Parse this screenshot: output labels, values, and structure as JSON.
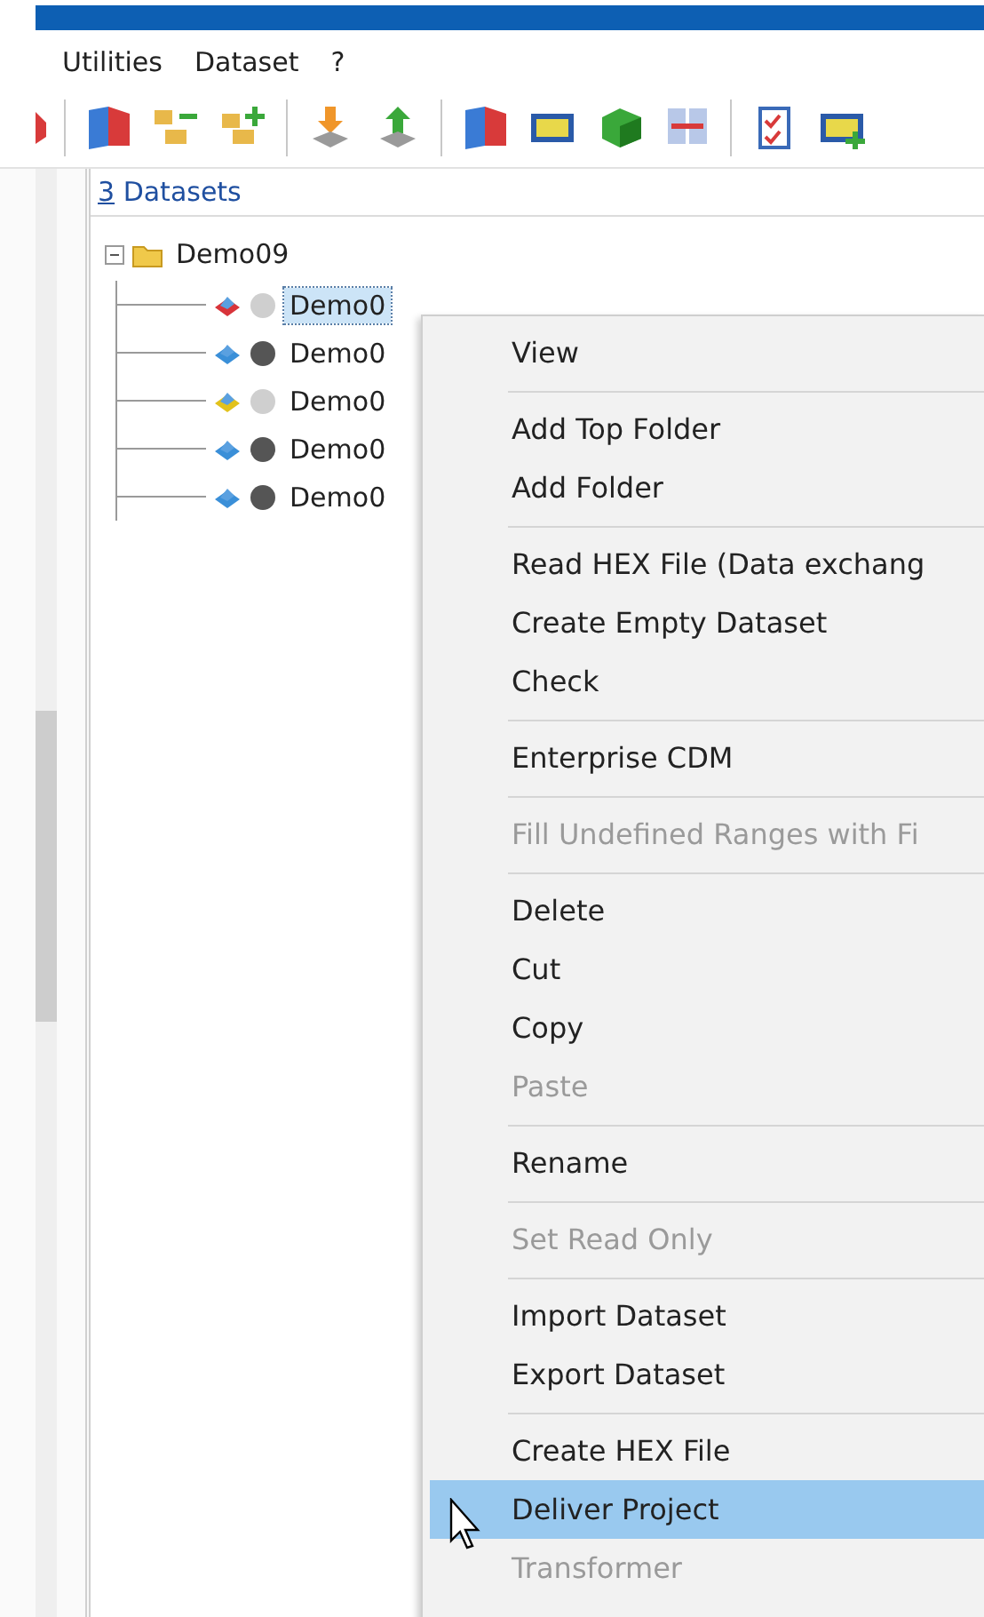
{
  "menu_bar": [
    "Utilities",
    "Dataset",
    "?"
  ],
  "panel": {
    "title_key": "3",
    "title": " Datasets"
  },
  "tree": [
    {
      "label": "Demo09",
      "expanded": true,
      "children": [
        {
          "label": "Demo0",
          "selected": true,
          "color": "#d8343a",
          "kind": "light"
        },
        {
          "label": "Demo0",
          "selected": false,
          "color": "#3a8fd8",
          "kind": "dark"
        },
        {
          "label": "Demo0",
          "selected": false,
          "color": "#e2c21c",
          "kind": "light"
        },
        {
          "label": "Demo0",
          "selected": false,
          "color": "#3a8fd8",
          "kind": "dark"
        },
        {
          "label": "Demo0",
          "selected": false,
          "color": "#3a8fd8",
          "kind": "dark"
        }
      ]
    }
  ],
  "context_menu": [
    {
      "kind": "item",
      "label": "View",
      "disabled": false,
      "selected": false
    },
    {
      "kind": "separator"
    },
    {
      "kind": "item",
      "label": "Add Top Folder",
      "disabled": false,
      "selected": false
    },
    {
      "kind": "item",
      "label": "Add Folder",
      "disabled": false,
      "selected": false
    },
    {
      "kind": "separator"
    },
    {
      "kind": "item",
      "label": "Read HEX File (Data exchang",
      "disabled": false,
      "selected": false
    },
    {
      "kind": "item",
      "label": "Create Empty Dataset",
      "disabled": false,
      "selected": false
    },
    {
      "kind": "item",
      "label": "Check",
      "disabled": false,
      "selected": false
    },
    {
      "kind": "separator"
    },
    {
      "kind": "item",
      "label": "Enterprise CDM",
      "disabled": false,
      "selected": false
    },
    {
      "kind": "separator"
    },
    {
      "kind": "item",
      "label": "Fill Undefined Ranges with Fi",
      "disabled": true,
      "selected": false
    },
    {
      "kind": "separator"
    },
    {
      "kind": "item",
      "label": "Delete",
      "disabled": false,
      "selected": false
    },
    {
      "kind": "item",
      "label": "Cut",
      "disabled": false,
      "selected": false
    },
    {
      "kind": "item",
      "label": "Copy",
      "disabled": false,
      "selected": false
    },
    {
      "kind": "item",
      "label": "Paste",
      "disabled": true,
      "selected": false
    },
    {
      "kind": "separator"
    },
    {
      "kind": "item",
      "label": "Rename",
      "disabled": false,
      "selected": false
    },
    {
      "kind": "separator"
    },
    {
      "kind": "item",
      "label": "Set Read Only",
      "disabled": true,
      "selected": false
    },
    {
      "kind": "separator"
    },
    {
      "kind": "item",
      "label": "Import Dataset",
      "disabled": false,
      "selected": false
    },
    {
      "kind": "item",
      "label": "Export Dataset",
      "disabled": false,
      "selected": false
    },
    {
      "kind": "separator"
    },
    {
      "kind": "item",
      "label": "Create HEX File",
      "disabled": false,
      "selected": false
    },
    {
      "kind": "item",
      "label": "Deliver Project",
      "disabled": false,
      "selected": true
    },
    {
      "kind": "item",
      "label": "Transformer",
      "disabled": true,
      "selected": false
    }
  ]
}
